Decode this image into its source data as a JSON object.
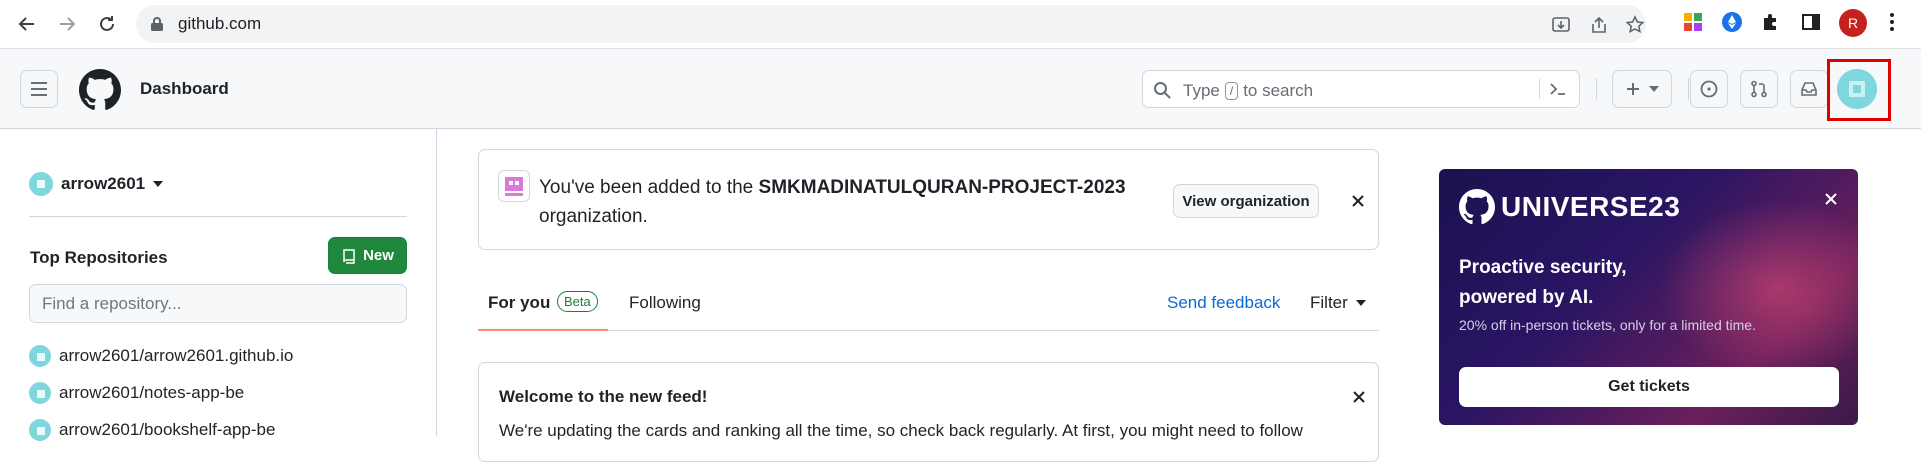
{
  "browser": {
    "url": "github.com"
  },
  "header": {
    "title": "Dashboard",
    "search_placeholder_prefix": "Type",
    "search_kbd": "/",
    "search_placeholder_suffix": "to search"
  },
  "sidebar": {
    "username": "arrow2601",
    "top_repositories_label": "Top Repositories",
    "new_button_label": "New",
    "find_placeholder": "Find a repository...",
    "repos": [
      "arrow2601/arrow2601.github.io",
      "arrow2601/notes-app-be",
      "arrow2601/bookshelf-app-be"
    ]
  },
  "notice": {
    "prefix": "You've been added to the",
    "org_name": "SMKMADINATULQURAN-PROJECT-2023",
    "suffix": "organization.",
    "button_label": "View organization"
  },
  "feed_tabs": {
    "for_you": "For you",
    "beta": "Beta",
    "following": "Following",
    "send_feedback": "Send feedback",
    "filter": "Filter"
  },
  "welcome": {
    "title": "Welcome to the new feed!",
    "description": "We're updating the cards and ranking all the time, so check back regularly. At first, you might need to follow"
  },
  "promo": {
    "brand": "UNIVERSE23",
    "headline_line1": "Proactive security,",
    "headline_line2": "powered by AI.",
    "subtext": "20% off in-person tickets, only for a limited time.",
    "cta": "Get tickets"
  },
  "colors": {
    "primary_green": "#1f883d",
    "link_blue": "#0969da",
    "highlight_red": "#e00000",
    "tab_underline": "#fd8c73"
  }
}
